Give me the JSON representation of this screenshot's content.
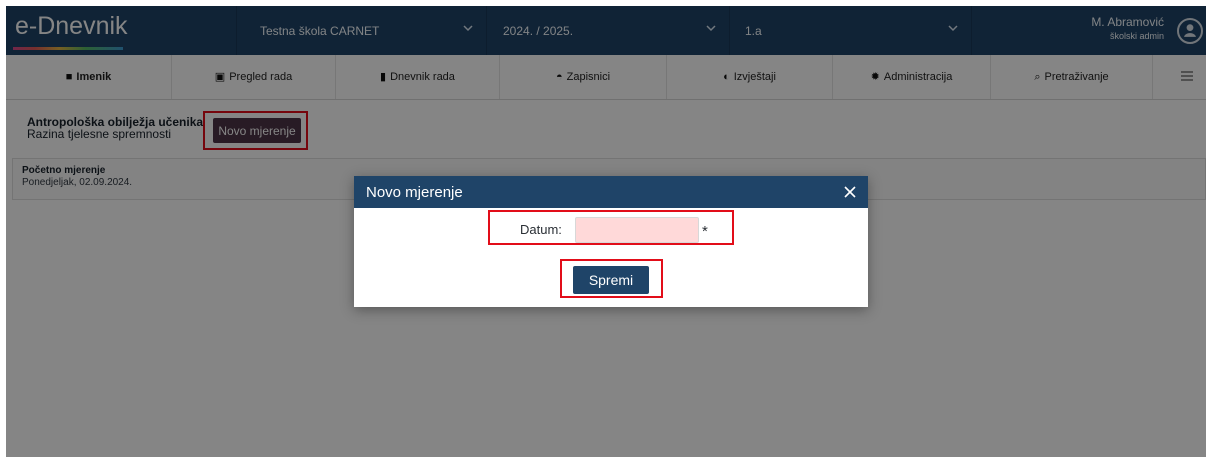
{
  "app": {
    "brand": "e-Dnevnik",
    "brand_colors": [
      "#d84b8e",
      "#e35b59",
      "#e3b544",
      "#56b965",
      "#3e9bd4"
    ],
    "header_color": "#1f4468"
  },
  "header": {
    "school": "Testna škola CARNET",
    "school_year": "2024. / 2025.",
    "class_name": "1.a",
    "user_name": "M. Abramović",
    "user_role": "školski admin",
    "icons": {
      "school_chevron": "chevron-down-icon",
      "year_chevron": "chevron-down-icon",
      "class_chevron": "chevron-down-icon",
      "avatar": "user-avatar-icon"
    }
  },
  "nav": {
    "items": [
      {
        "label": "Imenik",
        "icon": "book-icon",
        "symbol": "■",
        "active": true
      },
      {
        "label": "Pregled rada",
        "icon": "clipboard-icon",
        "symbol": "▣",
        "active": false
      },
      {
        "label": "Dnevnik rada",
        "icon": "notebook-icon",
        "symbol": "▮",
        "active": false
      },
      {
        "label": "Zapisnici",
        "icon": "briefcase-icon",
        "symbol": "◓",
        "active": false
      },
      {
        "label": "Izvještaji",
        "icon": "pie-chart-icon",
        "symbol": "◐",
        "active": false
      },
      {
        "label": "Administracija",
        "icon": "gear-icon",
        "symbol": "✹",
        "active": false
      },
      {
        "label": "Pretraživanje",
        "icon": "search-icon",
        "symbol": "⌕",
        "active": false
      }
    ],
    "menu_icon": "menu-icon"
  },
  "page": {
    "title": "Antropološka obilježja učenika",
    "subtitle": "Razina tjelesne spremnosti",
    "new_button": "Novo mjerenje",
    "measurement": {
      "title": "Početno mjerenje",
      "date": "Ponedjeljak, 02.09.2024."
    }
  },
  "modal": {
    "title": "Novo mjerenje",
    "date_label": "Datum:",
    "date_value": "",
    "required_mark": "*",
    "save_button": "Spremi",
    "close_icon": "close-icon"
  },
  "colors": {
    "navy": "#1f4468",
    "new_button": "#4d3447",
    "highlight": "#e20d19",
    "date_input": "#ffd9d9"
  }
}
